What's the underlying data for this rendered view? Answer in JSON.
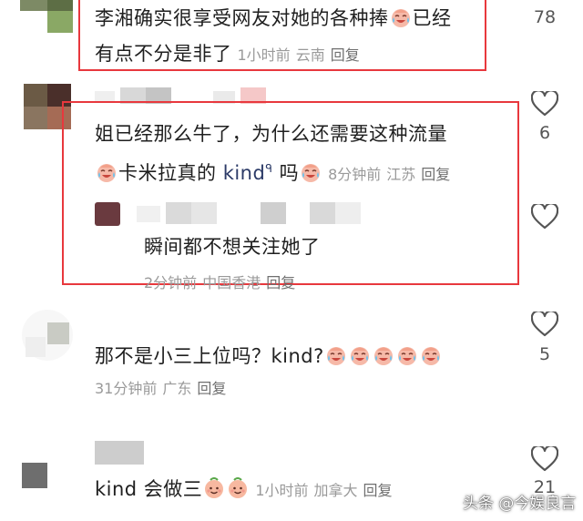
{
  "comments": [
    {
      "text_line1": "李湘确实很享受网友对她的各种捧",
      "text_tail": "已经",
      "text_line2": "有点不分是非了",
      "time": "1小时前",
      "location": "云南",
      "reply_label": "回复",
      "likes": "78"
    },
    {
      "text_line1": "姐已经那么牛了，为什么还需要这种流量",
      "text_line2_a": "卡米拉真的",
      "keyword": "kind",
      "search_glyph": "ᑫ",
      "text_line2_b": "吗",
      "time": "8分钟前",
      "location": "江苏",
      "reply_label": "回复",
      "likes": "6"
    },
    {
      "text": "瞬间都不想关注她了",
      "time": "2分钟前",
      "location": "中国香港",
      "reply_label": "回复"
    },
    {
      "text": "那不是小三上位吗？kind?",
      "time": "31分钟前",
      "location": "广东",
      "reply_label": "回复",
      "likes": "5"
    },
    {
      "text": "kind 会做三",
      "time": "1小时前",
      "location": "加拿大",
      "reply_label": "回复",
      "likes": "21"
    }
  ],
  "watermark": "头条 @今娱良言",
  "icons": {
    "like": "heart-outline-icon",
    "emoji_cry": "crying-laughing-emoji-icon",
    "emoji_smile": "smiling-emoji-icon"
  },
  "colors": {
    "highlight_border": "#e8383d",
    "meta_text": "#9a9a9a",
    "keyword_link": "#2b3a67"
  }
}
